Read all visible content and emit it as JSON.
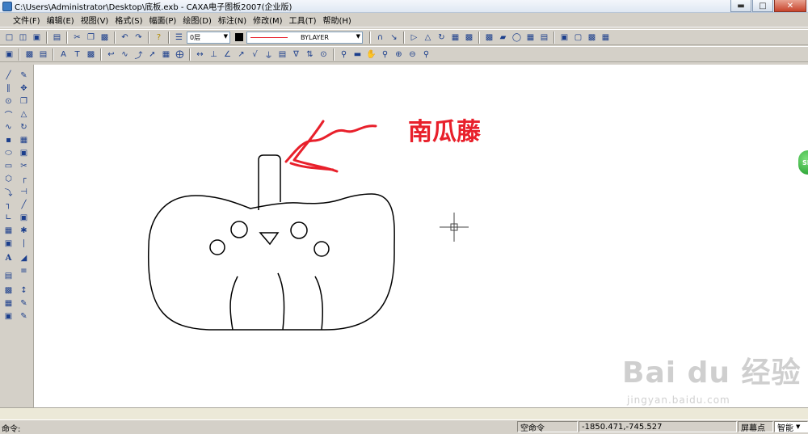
{
  "window": {
    "title": "C:\\Users\\Administrator\\Desktop\\底板.exb - CAXA电子图板2007(企业版)",
    "minimize_icon": "minimize-icon",
    "maximize_icon": "maximize-icon",
    "close_icon": "close-icon"
  },
  "menu": {
    "items": [
      "文件(F)",
      "编辑(E)",
      "视图(V)",
      "格式(S)",
      "幅面(P)",
      "绘图(D)",
      "标注(N)",
      "修改(M)",
      "工具(T)",
      "帮助(H)"
    ]
  },
  "toolbar": {
    "layer_value": "0层",
    "linetype_value": "BYLAYER",
    "color_value": "#000000"
  },
  "canvas": {
    "annotation": "南瓜藤",
    "annotation_color": "#e8202b",
    "sb_badge": "SB"
  },
  "watermark": {
    "brand": "Bai du 经验",
    "url": "jingyan.baidu.com"
  },
  "status": {
    "command_label": "命令:",
    "command_state": "空命令",
    "coords": "-1850.471,-745.527",
    "snap_label": "屏幕点",
    "smart": "智能"
  }
}
